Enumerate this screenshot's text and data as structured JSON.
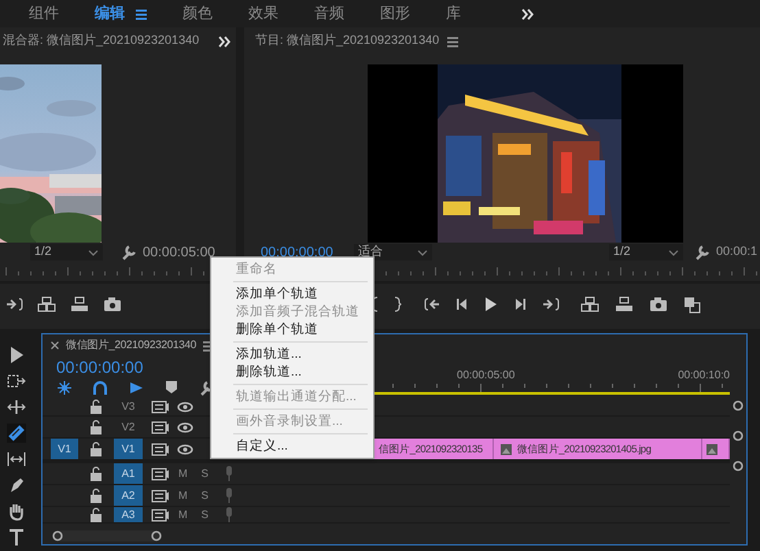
{
  "workspaces": [
    {
      "label": "组件",
      "selected": false
    },
    {
      "label": "编辑",
      "selected": true
    },
    {
      "label": "颜色",
      "selected": false
    },
    {
      "label": "效果",
      "selected": false
    },
    {
      "label": "音频",
      "selected": false
    },
    {
      "label": "图形",
      "selected": false
    },
    {
      "label": "库",
      "selected": false
    }
  ],
  "source_panel": {
    "title": "混合器: 微信图片_20210923201340",
    "resolution": "1/2",
    "timecode": "00:00:05:00"
  },
  "program_panel": {
    "title": "节目: 微信图片_20210923201340",
    "timecode": "00:00:00:00",
    "fit": "适合",
    "resolution": "1/2",
    "duration": "00:00:1"
  },
  "timeline": {
    "title": "微信图片_20210923201340",
    "timecode": "00:00:00:00",
    "ruler_labels": [
      "00:00:05:00",
      "00:00:10:0"
    ],
    "tracks": [
      {
        "kind": "video",
        "name": "V3",
        "targeted": false
      },
      {
        "kind": "video",
        "name": "V2",
        "targeted": false
      },
      {
        "kind": "video",
        "name": "V1",
        "targeted": true,
        "source_patch": "V1"
      },
      {
        "kind": "audio",
        "name": "A1",
        "targeted": true,
        "mute": "M",
        "solo": "S"
      },
      {
        "kind": "audio",
        "name": "A2",
        "targeted": true,
        "mute": "M",
        "solo": "S"
      },
      {
        "kind": "audio",
        "name": "A3",
        "targeted": true,
        "mute": "M",
        "solo": "S"
      }
    ],
    "clips": [
      {
        "label": "信图片_2021092320135"
      },
      {
        "label": "微信图片_20210923201405.jpg",
        "icon": true
      },
      {
        "icon": true
      }
    ]
  },
  "context_menu": [
    {
      "kind": "item",
      "label": "重命名",
      "disabled": true
    },
    {
      "kind": "separator"
    },
    {
      "kind": "item",
      "label": "添加单个轨道",
      "disabled": false
    },
    {
      "kind": "item",
      "label": "添加音频子混合轨道",
      "disabled": true
    },
    {
      "kind": "item",
      "label": "删除单个轨道",
      "disabled": false
    },
    {
      "kind": "separator"
    },
    {
      "kind": "item",
      "label": "添加轨道...",
      "disabled": false
    },
    {
      "kind": "item",
      "label": "删除轨道...",
      "disabled": false
    },
    {
      "kind": "separator"
    },
    {
      "kind": "item",
      "label": "轨道输出通道分配...",
      "disabled": true
    },
    {
      "kind": "separator"
    },
    {
      "kind": "item",
      "label": "画外音录制设置...",
      "disabled": true
    },
    {
      "kind": "separator"
    },
    {
      "kind": "item",
      "label": "自定义...",
      "disabled": false
    }
  ]
}
